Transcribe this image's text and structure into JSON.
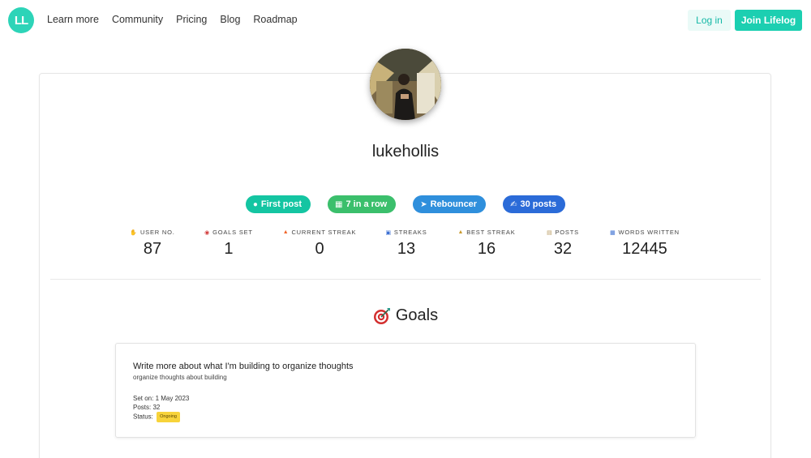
{
  "nav": {
    "logo_text": "LL",
    "links": [
      "Learn more",
      "Community",
      "Pricing",
      "Blog",
      "Roadmap"
    ],
    "login_label": "Log in",
    "join_label": "Join Lifelog"
  },
  "profile": {
    "username": "lukehollis",
    "badges": [
      {
        "icon": "egg-icon",
        "label": "First post",
        "color": "#14c5a2"
      },
      {
        "icon": "slot-icon",
        "label": "7 in a row",
        "color": "#3bbf6c"
      },
      {
        "icon": "bounce-icon",
        "label": "Rebouncer",
        "color": "#2f8fdc"
      },
      {
        "icon": "writing-icon",
        "label": "30 posts",
        "color": "#2b6bd8"
      }
    ],
    "stats": [
      {
        "icon": "hand-icon",
        "label": "USER NO.",
        "value": "87"
      },
      {
        "icon": "target-icon",
        "label": "GOALS SET",
        "value": "1"
      },
      {
        "icon": "fire-icon",
        "label": "CURRENT STREAK",
        "value": "0"
      },
      {
        "icon": "calendar-icon",
        "label": "STREAKS",
        "value": "13"
      },
      {
        "icon": "trophy-icon",
        "label": "BEST STREAK",
        "value": "16"
      },
      {
        "icon": "scroll-icon",
        "label": "POSTS",
        "value": "32"
      },
      {
        "icon": "abcd-icon",
        "label": "WORDS WRITTEN",
        "value": "12445"
      }
    ]
  },
  "goals": {
    "title": "Goals",
    "items": [
      {
        "title": "Write more about what I'm building to organize thoughts",
        "description": "organize thoughts about building",
        "set_on": "Set on: 1 May 2023",
        "posts": "Posts: 32",
        "status_label": "Status:",
        "status": "Ongoing"
      }
    ]
  }
}
